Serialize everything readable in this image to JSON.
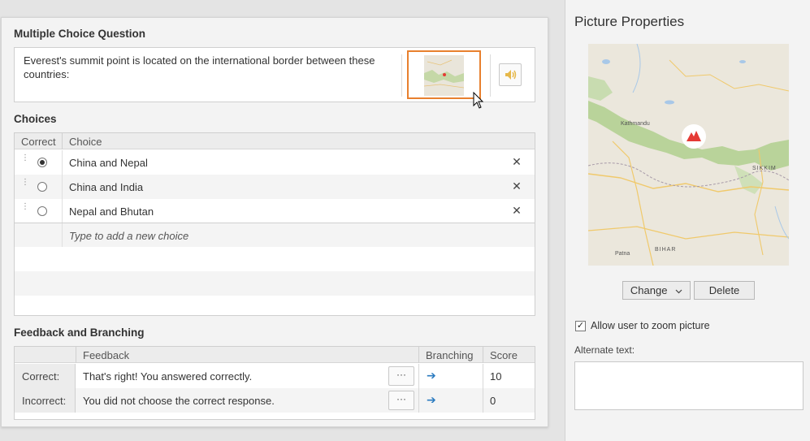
{
  "question": {
    "section_title": "Multiple Choice Question",
    "text": "Everest's summit point is located on the international border between these countries:"
  },
  "choices": {
    "section_title": "Choices",
    "header": {
      "correct": "Correct",
      "choice": "Choice"
    },
    "items": [
      {
        "label": "China and Nepal",
        "correct": true
      },
      {
        "label": "China and India",
        "correct": false
      },
      {
        "label": "Nepal and Bhutan",
        "correct": false
      }
    ],
    "add_placeholder": "Type to add a new choice"
  },
  "feedback": {
    "section_title": "Feedback and Branching",
    "header": {
      "feedback": "Feedback",
      "branching": "Branching",
      "score": "Score"
    },
    "rows": [
      {
        "label": "Correct:",
        "text": "That's right! You answered correctly.",
        "dots": "···",
        "branch_icon": "arrow-right-icon",
        "score": "10"
      },
      {
        "label": "Incorrect:",
        "text": "You did not choose the correct response.",
        "dots": "···",
        "branch_icon": "arrow-right-icon",
        "score": "0"
      }
    ]
  },
  "picture_properties": {
    "title": "Picture Properties",
    "change_label": "Change",
    "delete_label": "Delete",
    "zoom_label": "Allow user to zoom picture",
    "zoom_checked": true,
    "alt_text_label": "Alternate text:",
    "alt_text_value": "",
    "map_labels": [
      "Kathmandu",
      "SIKKIM",
      "BIHAR",
      "Patna"
    ]
  },
  "colors": {
    "accent_orange": "#e8802e",
    "arrow_blue": "#2b7bc0",
    "marker_red": "#e53a35"
  }
}
